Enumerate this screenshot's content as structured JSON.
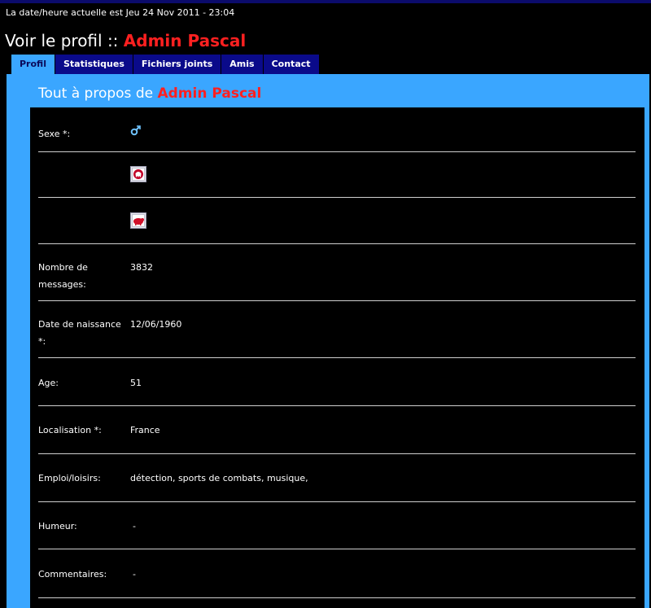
{
  "header": {
    "datetime": "La date/heure actuelle est Jeu 24 Nov 2011 - 23:04",
    "title_prefix": "Voir le profil :: ",
    "username": "Admin Pascal"
  },
  "tabs": [
    {
      "label": "Profil",
      "active": true
    },
    {
      "label": "Statistiques",
      "active": false
    },
    {
      "label": "Fichiers joints",
      "active": false
    },
    {
      "label": "Amis",
      "active": false
    },
    {
      "label": "Contact",
      "active": false
    }
  ],
  "section": {
    "title_prefix": "Tout à propos de ",
    "username": "Admin Pascal"
  },
  "fields": {
    "sexe": {
      "label": "Sexe *:",
      "icon": "male-gender-icon"
    },
    "badge1": {
      "icon": "red-badge-icon"
    },
    "badge2": {
      "icon": "red-pig-icon"
    },
    "messages": {
      "label": "Nombre de messages:",
      "value": "3832"
    },
    "naissance": {
      "label": "Date de naissance *:",
      "value": "12/06/1960"
    },
    "age": {
      "label": "Age:",
      "value": "51"
    },
    "localisation": {
      "label": "Localisation *:",
      "value": "France"
    },
    "emploi": {
      "label": "Emploi/loisirs:",
      "value": "détection, sports de combats, musique,"
    },
    "humeur": {
      "label": "Humeur:",
      "value": "-"
    },
    "commentaires": {
      "label": "Commentaires:",
      "value": "-"
    }
  },
  "colors": {
    "background": "#000000",
    "panel": "#3aa6ff",
    "tab": "#0a0a8a",
    "username": "#ff2020"
  }
}
